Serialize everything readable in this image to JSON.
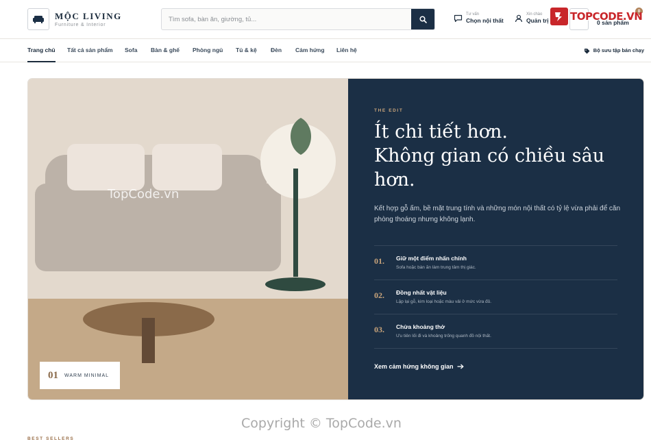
{
  "brand": {
    "name": "MỘC LIVING",
    "tagline": "Furniture & Interior",
    "icon": "sofa-icon"
  },
  "search": {
    "placeholder": "Tìm sofa, bàn ăn, giường, tủ...",
    "icon": "search-icon"
  },
  "header_actions": {
    "advice": {
      "small": "Tư vấn",
      "label": "Chọn nội thất",
      "icon": "chat-icon"
    },
    "account": {
      "small": "Xin chào",
      "label": "Quản trị",
      "icon": "user-icon"
    },
    "cart": {
      "label": "0 sản phẩm",
      "count": "0",
      "icon": "cart-icon"
    }
  },
  "watermark": {
    "logo": "TOPCODE.VN",
    "overlay": "TopCode.vn",
    "copyright": "Copyright © TopCode.vn"
  },
  "nav": {
    "items": [
      {
        "label": "Trang chủ",
        "active": true
      },
      {
        "label": "Tất cả sản phẩm"
      },
      {
        "label": "Sofa"
      },
      {
        "label": "Bàn & ghế"
      },
      {
        "label": "Phòng ngủ"
      },
      {
        "label": "Tủ & kệ"
      },
      {
        "label": "Đèn"
      },
      {
        "label": "Cảm hứng"
      },
      {
        "label": "Liên hệ"
      }
    ],
    "collection": "Bộ sưu tập bán chạy"
  },
  "hero": {
    "badge": {
      "number": "01",
      "label": "WARM MINIMAL"
    },
    "eyebrow": "THE EDIT",
    "headline": [
      "Ít chi tiết hơn.",
      "Không gian có chiều sâu",
      "hơn."
    ],
    "lead": "Kết hợp gỗ ấm, bề mặt trung tính và những món nội thất có tỷ lệ vừa phải để căn phòng thoáng nhưng không lạnh.",
    "points": [
      {
        "num": "01.",
        "title": "Giữ một điểm nhấn chính",
        "desc": "Sofa hoặc bàn ăn làm trung tâm thị giác."
      },
      {
        "num": "02.",
        "title": "Đồng nhất vật liệu",
        "desc": "Lặp lại gỗ, kim loại hoặc màu vải ở mức vừa đủ."
      },
      {
        "num": "03.",
        "title": "Chừa khoảng thở",
        "desc": "Ưu tiên lối đi và khoảng trống quanh đồ nội thất."
      }
    ],
    "cta": "Xem cảm hứng không gian"
  },
  "section": {
    "eyebrow": "BEST SELLERS"
  },
  "colors": {
    "navy": "#1b2f45",
    "accent": "#c9a47b",
    "wall": "#e3d9cd",
    "floor": "#c4a988",
    "sofa": "#bcb2a8",
    "lamp": "#2f4a40"
  }
}
